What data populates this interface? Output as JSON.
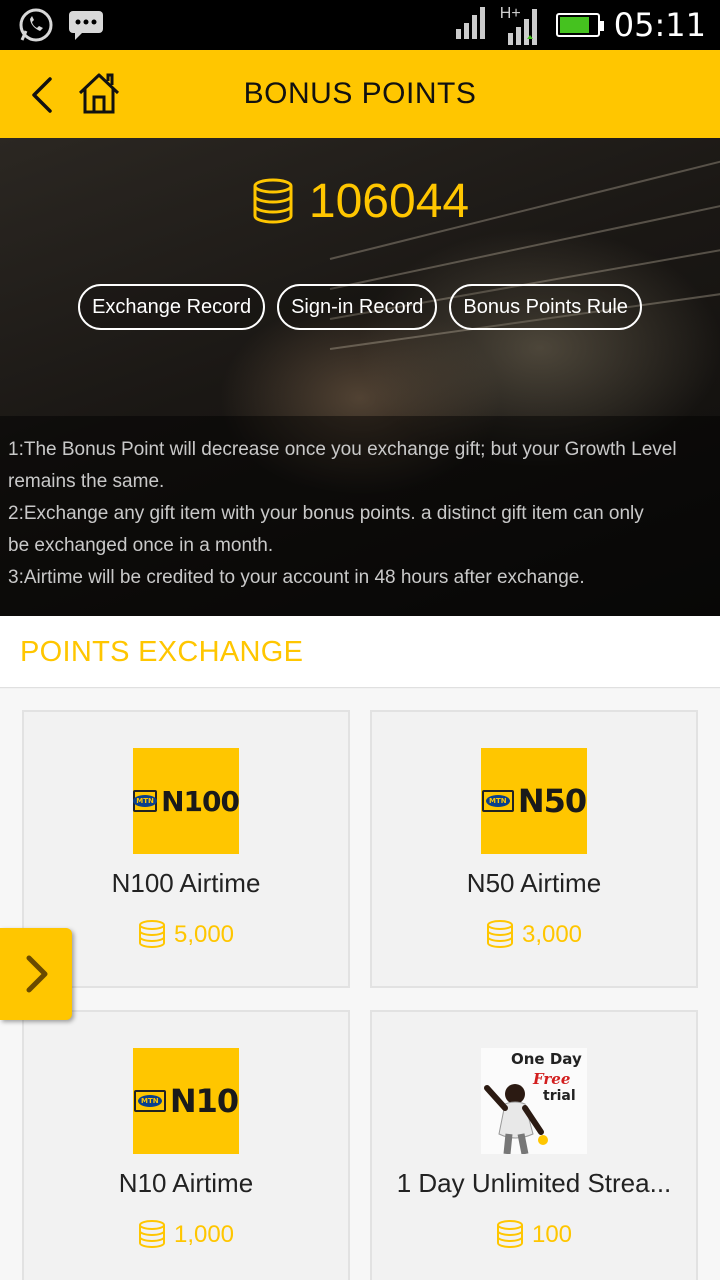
{
  "status_bar": {
    "time": "05:11",
    "network_label": "H+",
    "left_icons": [
      "whatsapp-icon",
      "messenger-icon"
    ],
    "battery_level": 0.8
  },
  "header": {
    "title": "BONUS POINTS",
    "back_icon": "back-chevron-icon",
    "home_icon": "home-icon",
    "background_color": "#ffc600"
  },
  "hero": {
    "points": "106044",
    "buttons": [
      "Exchange Record",
      "Sign-in Record",
      "Bonus Points Rule"
    ],
    "rules": [
      "1:The Bonus Point will decrease once you exchange gift; but your Growth Level",
      "remains the same.",
      "2:Exchange any gift item with your bonus points. a distinct gift item can only",
      "be exchanged once in a month.",
      "3:Airtime will be credited to your account in 48 hours after exchange."
    ]
  },
  "exchange": {
    "section_title": "POINTS EXCHANGE",
    "accent_color": "#ffc600",
    "items": [
      {
        "name": "N100 Airtime",
        "cost": "5,000",
        "image_label": "N100",
        "logo": "MTN"
      },
      {
        "name": "N50 Airtime",
        "cost": "3,000",
        "image_label": "N50",
        "logo": "MTN"
      },
      {
        "name": "N10 Airtime",
        "cost": "1,000",
        "image_label": "N10",
        "logo": "MTN"
      },
      {
        "name": "1 Day Unlimited Strea...",
        "cost": "100",
        "image_lines": [
          "One Day",
          "Free",
          "trial"
        ]
      }
    ]
  },
  "floating_button": {
    "icon": "chevron-right-icon"
  }
}
